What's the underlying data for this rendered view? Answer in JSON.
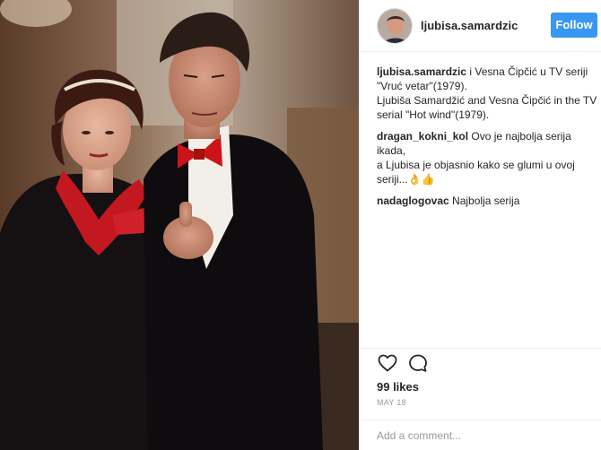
{
  "post": {
    "username": "ljubisa.samardzic",
    "follow_label": "Follow",
    "photo_alt": "",
    "caption": {
      "user": "ljubisa.samardzic",
      "line1": " i Vesna Čipčić u TV seriji",
      "line2": "\"Vruć vetar\"(1979).",
      "line3": "Ljubiša Samardžić and Vesna Čipčić in the TV",
      "line4": "serial \"Hot wind\"(1979)."
    },
    "comments": [
      {
        "user": "dragan_kokni_kol",
        "line1": " Ovo je najbolja serija ikada,",
        "line2": "a Ljubisa je objasnio kako se glumi u ovoj",
        "line3": "seriji...👌👍"
      },
      {
        "user": "nadaglogovac",
        "line1": " Najbolja serija"
      }
    ],
    "likes": "99 likes",
    "date": "MAY 18",
    "add_comment_placeholder": "Add a comment...",
    "icons": {
      "like": "heart-icon",
      "comment": "comment-bubble-icon"
    },
    "colors": {
      "follow_button": "#3897f0",
      "divider": "#efefef",
      "muted_text": "#999999"
    }
  }
}
